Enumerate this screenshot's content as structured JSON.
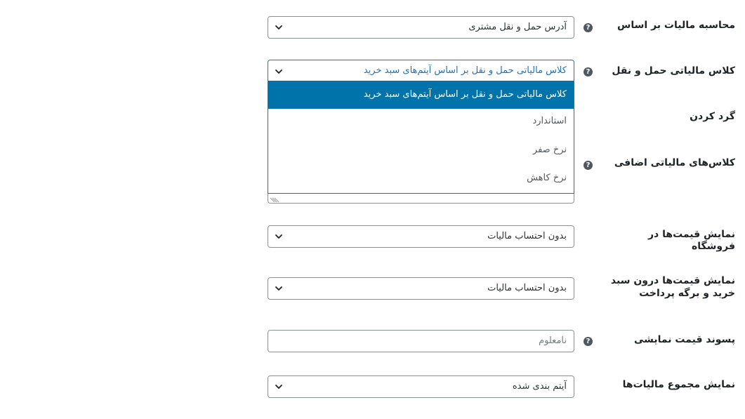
{
  "fields": {
    "tax_based_on": {
      "label": "محاسبه مالیات بر اساس",
      "value": "آدرس حمل و نقل مشتری"
    },
    "shipping_tax_class": {
      "label": "کلاس مالیاتی حمل و نقل",
      "value": "کلاس مالیاتی حمل و نقل بر اساس آیتم‌های سبد خرید"
    },
    "rounding": {
      "label": "گرد کردن"
    },
    "additional_tax_classes": {
      "label": "کلاس‌های مالیاتی اضافی"
    },
    "display_prices_shop": {
      "label": "نمایش قیمت‌ها در فروشگاه",
      "value": "بدون احتساب مالیات"
    },
    "display_prices_cart": {
      "label": "نمایش قیمت‌ها درون سبد خرید و برگه پرداخت",
      "value": "بدون احتساب مالیات"
    },
    "price_display_suffix": {
      "label": "پسوند قیمت نمایشی",
      "placeholder": "نامعلوم"
    },
    "display_tax_totals": {
      "label": "نمایش مجموع مالیات‌ها",
      "value": "آیتم بندی شده"
    }
  },
  "dropdown": {
    "options": [
      "کلاس مالیاتی حمل و نقل بر اساس آیتم‌های سبد خرید",
      "استاندارد",
      "نرخ صفر",
      "نرخ کاهش"
    ],
    "selected_index": 0
  },
  "icons": {
    "help": "question-circle-icon",
    "chevron": "chevron-down-icon",
    "resize": "resize-grip-icon"
  },
  "help_glyph": "?",
  "colors": {
    "accent": "#2271b1",
    "selected_option_bg": "#0073aa",
    "border": "#8c8f94",
    "help_icon": "#50575e",
    "label_text": "#1d2327"
  }
}
